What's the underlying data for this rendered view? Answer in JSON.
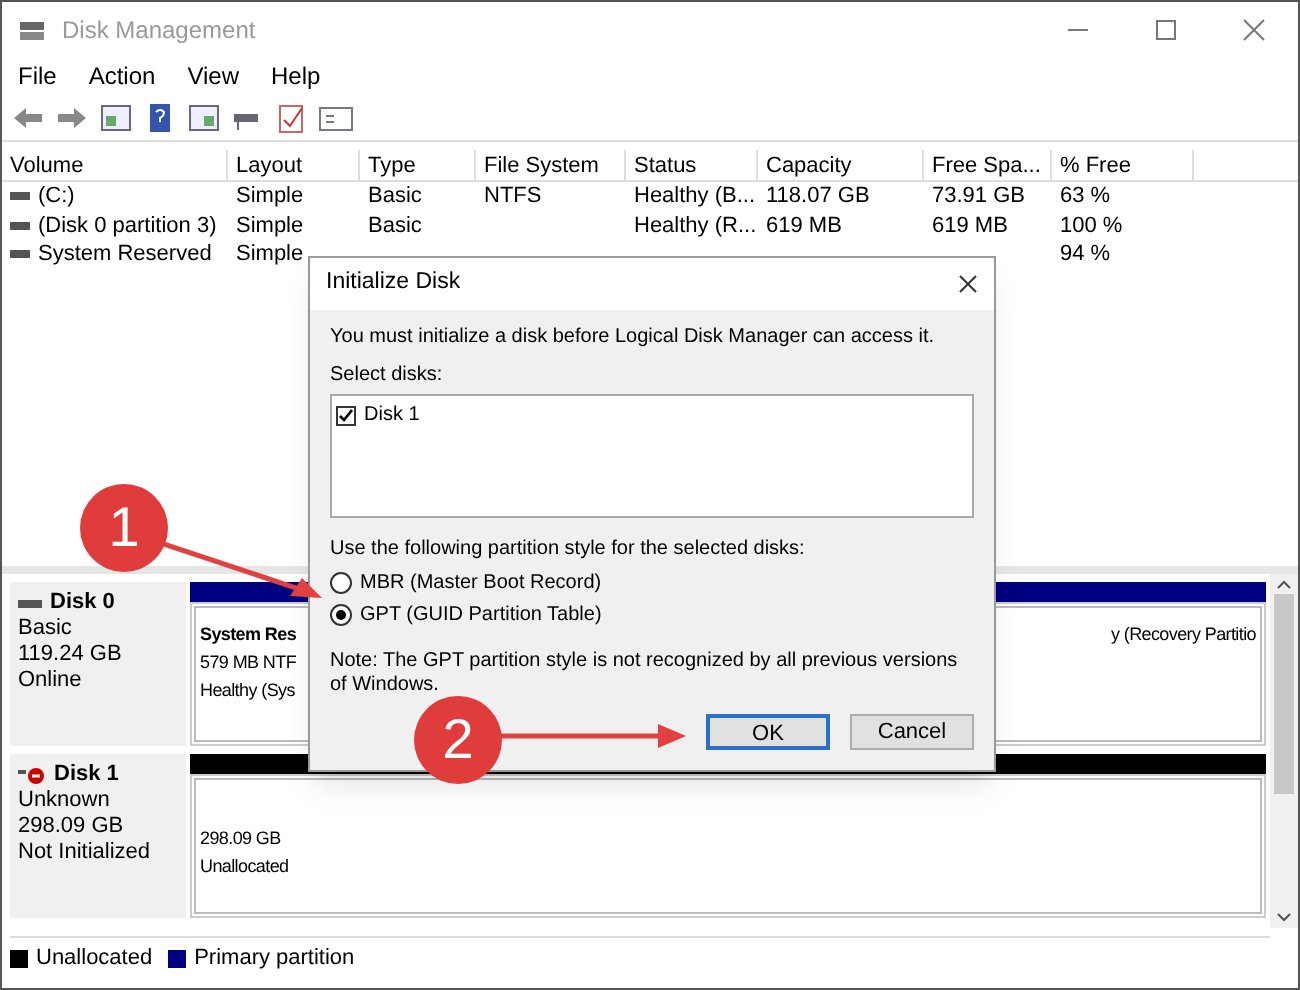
{
  "window": {
    "title": "Disk Management"
  },
  "menu": [
    "File",
    "Action",
    "View",
    "Help"
  ],
  "table": {
    "columns": [
      "Volume",
      "Layout",
      "Type",
      "File System",
      "Status",
      "Capacity",
      "Free Spa...",
      "% Free"
    ],
    "rows": [
      {
        "cells": [
          "(C:)",
          "Simple",
          "Basic",
          "NTFS",
          "Healthy (B...",
          "118.07 GB",
          "73.91 GB",
          "63 %"
        ]
      },
      {
        "cells": [
          "(Disk 0 partition 3)",
          "Simple",
          "Basic",
          "",
          "Healthy (R...",
          "619 MB",
          "619 MB",
          "100 %"
        ]
      },
      {
        "cells": [
          "System Reserved",
          "Simple",
          "",
          "",
          "",
          "",
          "",
          "94 %"
        ]
      }
    ]
  },
  "disks": [
    {
      "name": "Disk 0",
      "kind": "online",
      "info": [
        "Basic",
        "119.24 GB",
        "Online"
      ],
      "partitions": [
        {
          "kind": "system",
          "title": "System Res",
          "lines": [
            "579 MB NTF",
            "Healthy (Sys"
          ]
        },
        {
          "kind": "recovery",
          "lines": [
            "y (Recovery Partitio"
          ]
        }
      ]
    },
    {
      "name": "Disk 1",
      "kind": "uninitialized",
      "info": [
        "Unknown",
        "298.09 GB",
        "Not Initialized"
      ],
      "partitions": [
        {
          "kind": "unallocated",
          "lines": [
            "298.09 GB",
            "Unallocated"
          ]
        }
      ]
    }
  ],
  "legend": [
    {
      "label": "Unallocated",
      "color": "#000000"
    },
    {
      "label": "Primary partition",
      "color": "#000080"
    }
  ],
  "dialog": {
    "title": "Initialize Disk",
    "message": "You must initialize a disk before Logical Disk Manager can access it.",
    "select_label": "Select disks:",
    "disks": [
      {
        "label": "Disk 1",
        "checked": true
      }
    ],
    "style_label": "Use the following partition style for the selected disks:",
    "styles": [
      {
        "label": "MBR (Master Boot Record)",
        "selected": false
      },
      {
        "label": "GPT (GUID Partition Table)",
        "selected": true
      }
    ],
    "note": "Note: The GPT partition style is not recognized by all previous versions of Windows.",
    "buttons": [
      {
        "label": "OK",
        "kind": "default"
      },
      {
        "label": "Cancel",
        "kind": "normal"
      }
    ]
  },
  "annotations": [
    {
      "label": "1"
    },
    {
      "label": "2"
    }
  ]
}
